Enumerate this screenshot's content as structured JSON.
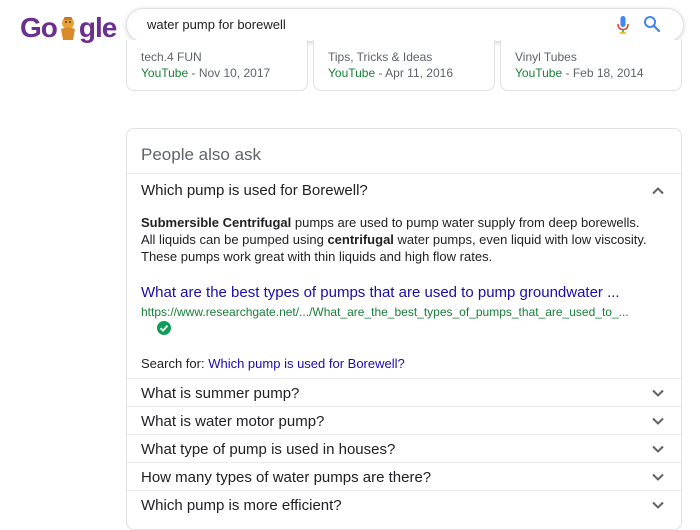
{
  "logo": {
    "g": "G",
    "o": "o",
    "rest": "gle"
  },
  "search": {
    "query": "water pump for borewell"
  },
  "cards": [
    {
      "channel": "tech.4 FUN",
      "source": "YouTube",
      "date": " - Nov 10, 2017"
    },
    {
      "channel": "Tips, Tricks & Ideas",
      "source": "YouTube",
      "date": " - Apr 11, 2016"
    },
    {
      "channel": "Vinyl Tubes",
      "source": "YouTube",
      "date": " - Feb 18, 2014"
    }
  ],
  "paa": {
    "title": "People also ask",
    "expanded": {
      "question": "Which pump is used for Borewell?",
      "answer": {
        "bold1": "Submersible Centrifugal",
        "text1": " pumps are used to pump water supply from deep borewells. All liquids can be pumped using ",
        "bold2": "centrifugal",
        "text2": " water pumps, even liquid with low viscosity. These pumps work great with thin liquids and high flow rates."
      },
      "link_title": "What are the best types of pumps that are used to pump groundwater ...",
      "link_url": "https://www.researchgate.net/.../What_are_the_best_types_of_pumps_that_are_used_to_...",
      "search_for_label": "Search for: ",
      "search_for_link": "Which pump is used for Borewell?"
    },
    "questions": [
      "What is summer pump?",
      "What is water motor pump?",
      "What type of pump is used in houses?",
      "How many types of water pumps are there?",
      "Which pump is more efficient?"
    ]
  },
  "colors": {
    "link": "#1a0dab",
    "url": "#188038",
    "logo": "#6b2f8f"
  }
}
